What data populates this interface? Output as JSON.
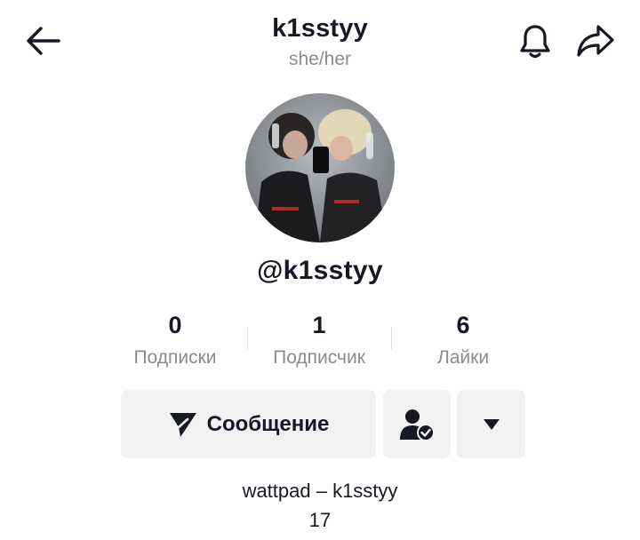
{
  "header": {
    "username": "k1sstyy",
    "pronouns": "she/her",
    "icons": {
      "back": "arrow-left-icon",
      "bell": "bell-icon",
      "share": "share-arrow-icon"
    }
  },
  "profile": {
    "handle": "@k1sstyy",
    "avatar": "profile-photo"
  },
  "stats": [
    {
      "value": "0",
      "label": "Подписки"
    },
    {
      "value": "1",
      "label": "Подписчик"
    },
    {
      "value": "6",
      "label": "Лайки"
    }
  ],
  "actions": {
    "message_label": "Сообщение",
    "message_icon": "send-icon",
    "follow_icon": "user-check-icon",
    "more_icon": "caret-down-icon"
  },
  "bio": {
    "line1": "wattpad – k1sstyy",
    "line2": "17"
  },
  "colors": {
    "text": "#161823",
    "secondary": "#8a8b91",
    "button_bg": "#f1f1f2"
  }
}
